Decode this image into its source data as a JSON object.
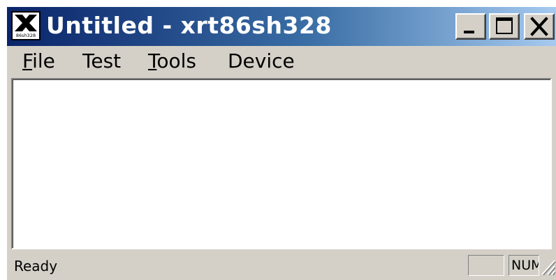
{
  "window": {
    "title": "Untitled - xrt86sh328",
    "icon": "xr-app-icon",
    "icon_text": "86sh328",
    "controls": {
      "minimize_icon": "minimize-icon",
      "maximize_icon": "maximize-icon",
      "close_icon": "close-icon"
    }
  },
  "menu": {
    "file": {
      "mnemonic": "F",
      "rest": "ile"
    },
    "test": {
      "label": "Test"
    },
    "tools": {
      "mnemonic": "T",
      "rest": "ools"
    },
    "device": {
      "label": "Device"
    }
  },
  "statusbar": {
    "text": "Ready",
    "num_indicator": "NUM"
  },
  "colors": {
    "title_start": "#0a246a",
    "title_end": "#a6caf0",
    "face": "#d4d0c8",
    "client": "#ffffff"
  }
}
